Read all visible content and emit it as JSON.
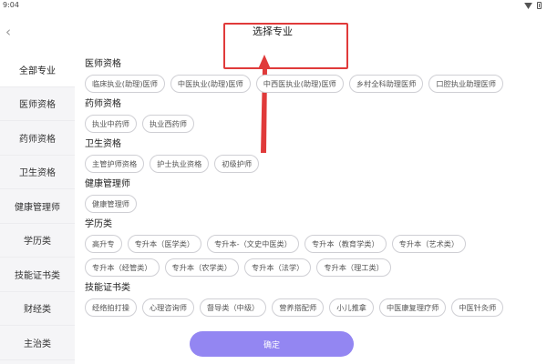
{
  "status_bar": {
    "time": "9:04"
  },
  "header": {
    "title": "选择专业",
    "back_icon": "chevron-left-icon"
  },
  "annotation": {
    "box_color": "#e03a3a",
    "arrow_color": "#e03a3a"
  },
  "sidebar": {
    "items": [
      {
        "label": "全部专业",
        "active": true
      },
      {
        "label": "医师资格",
        "active": false
      },
      {
        "label": "药师资格",
        "active": false
      },
      {
        "label": "卫生资格",
        "active": false
      },
      {
        "label": "健康管理师",
        "active": false
      },
      {
        "label": "学历类",
        "active": false
      },
      {
        "label": "技能证书类",
        "active": false
      },
      {
        "label": "财经类",
        "active": false
      },
      {
        "label": "主治类",
        "active": false
      }
    ]
  },
  "sections": [
    {
      "title": "医师资格",
      "chips": [
        "临床执业(助理)医师",
        "中医执业(助理)医师",
        "中西医执业(助理)医师",
        "乡村全科助理医师",
        "口腔执业助理医师"
      ]
    },
    {
      "title": "药师资格",
      "chips": [
        "执业中药师",
        "执业西药师"
      ]
    },
    {
      "title": "卫生资格",
      "chips": [
        "主管护师资格",
        "护士执业资格",
        "初级护师"
      ]
    },
    {
      "title": "健康管理师",
      "chips": [
        "健康管理师"
      ]
    },
    {
      "title": "学历类",
      "chips": [
        "高升专",
        "专升本（医学类）",
        "专升本-（文史中医类）",
        "专升本（教育学类）",
        "专升本（艺术类）",
        "专升本（经管类）",
        "专升本（农学类）",
        "专升本（法学）",
        "专升本（理工类）"
      ]
    },
    {
      "title": "技能证书类",
      "chips": [
        "经络拍打操",
        "心理咨询师",
        "督导类（中级）",
        "营养搭配师",
        "小儿推拿",
        "中医康复理疗师",
        "中医针灸师"
      ]
    }
  ],
  "confirm_button": {
    "label": "确定",
    "color": "#8a7cf1"
  }
}
